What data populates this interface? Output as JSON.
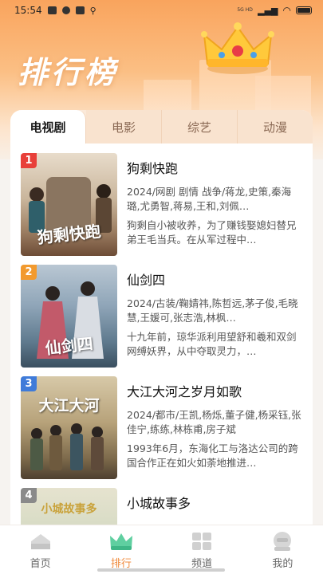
{
  "status_bar": {
    "time": "15:54",
    "network": "5G HD"
  },
  "header": {
    "title": "排行榜"
  },
  "tabs": [
    {
      "label": "电视剧",
      "active": true
    },
    {
      "label": "电影",
      "active": false
    },
    {
      "label": "综艺",
      "active": false
    },
    {
      "label": "动漫",
      "active": false
    }
  ],
  "items": [
    {
      "rank": "1",
      "rank_color": "#e8403a",
      "title": "狗剩快跑",
      "poster_text": "狗剩快跑",
      "meta": "2024/网剧 剧情 战争/蒋龙,史策,秦海璐,尤勇智,蒋易,王和,刘佩…",
      "desc": "狗剩自小被收养，为了赚钱娶媳妇替兄弟王毛当兵。在从军过程中…"
    },
    {
      "rank": "2",
      "rank_color": "#f29a2e",
      "title": "仙剑四",
      "poster_text": "仙剑四",
      "meta": "2024/古装/鞠婧祎,陈哲远,茅子俊,毛晓慧,王媛可,张志浩,林枫…",
      "desc": "十九年前，琼华派利用望舒和羲和双剑网缚妖界，从中夺取灵力，…"
    },
    {
      "rank": "3",
      "rank_color": "#3f7bd9",
      "title": "大江大河之岁月如歌",
      "poster_text": "大江大河",
      "meta": "2024/都市/王凯,杨烁,董子健,杨采钰,张佳宁,练练,林栋甫,房子斌",
      "desc": "1993年6月，东海化工与洛达公司的跨国合作正在如火如荼地推进…"
    },
    {
      "rank": "4",
      "rank_color": "#8a8a8a",
      "title": "小城故事多",
      "poster_text": "小城故事多",
      "meta": "",
      "desc": ""
    }
  ],
  "bottom_nav": [
    {
      "label": "首页",
      "icon": "home-icon",
      "active": false
    },
    {
      "label": "排行",
      "icon": "crown-icon",
      "active": true
    },
    {
      "label": "频道",
      "icon": "grid-icon",
      "active": false
    },
    {
      "label": "我的",
      "icon": "profile-icon",
      "active": false
    }
  ]
}
